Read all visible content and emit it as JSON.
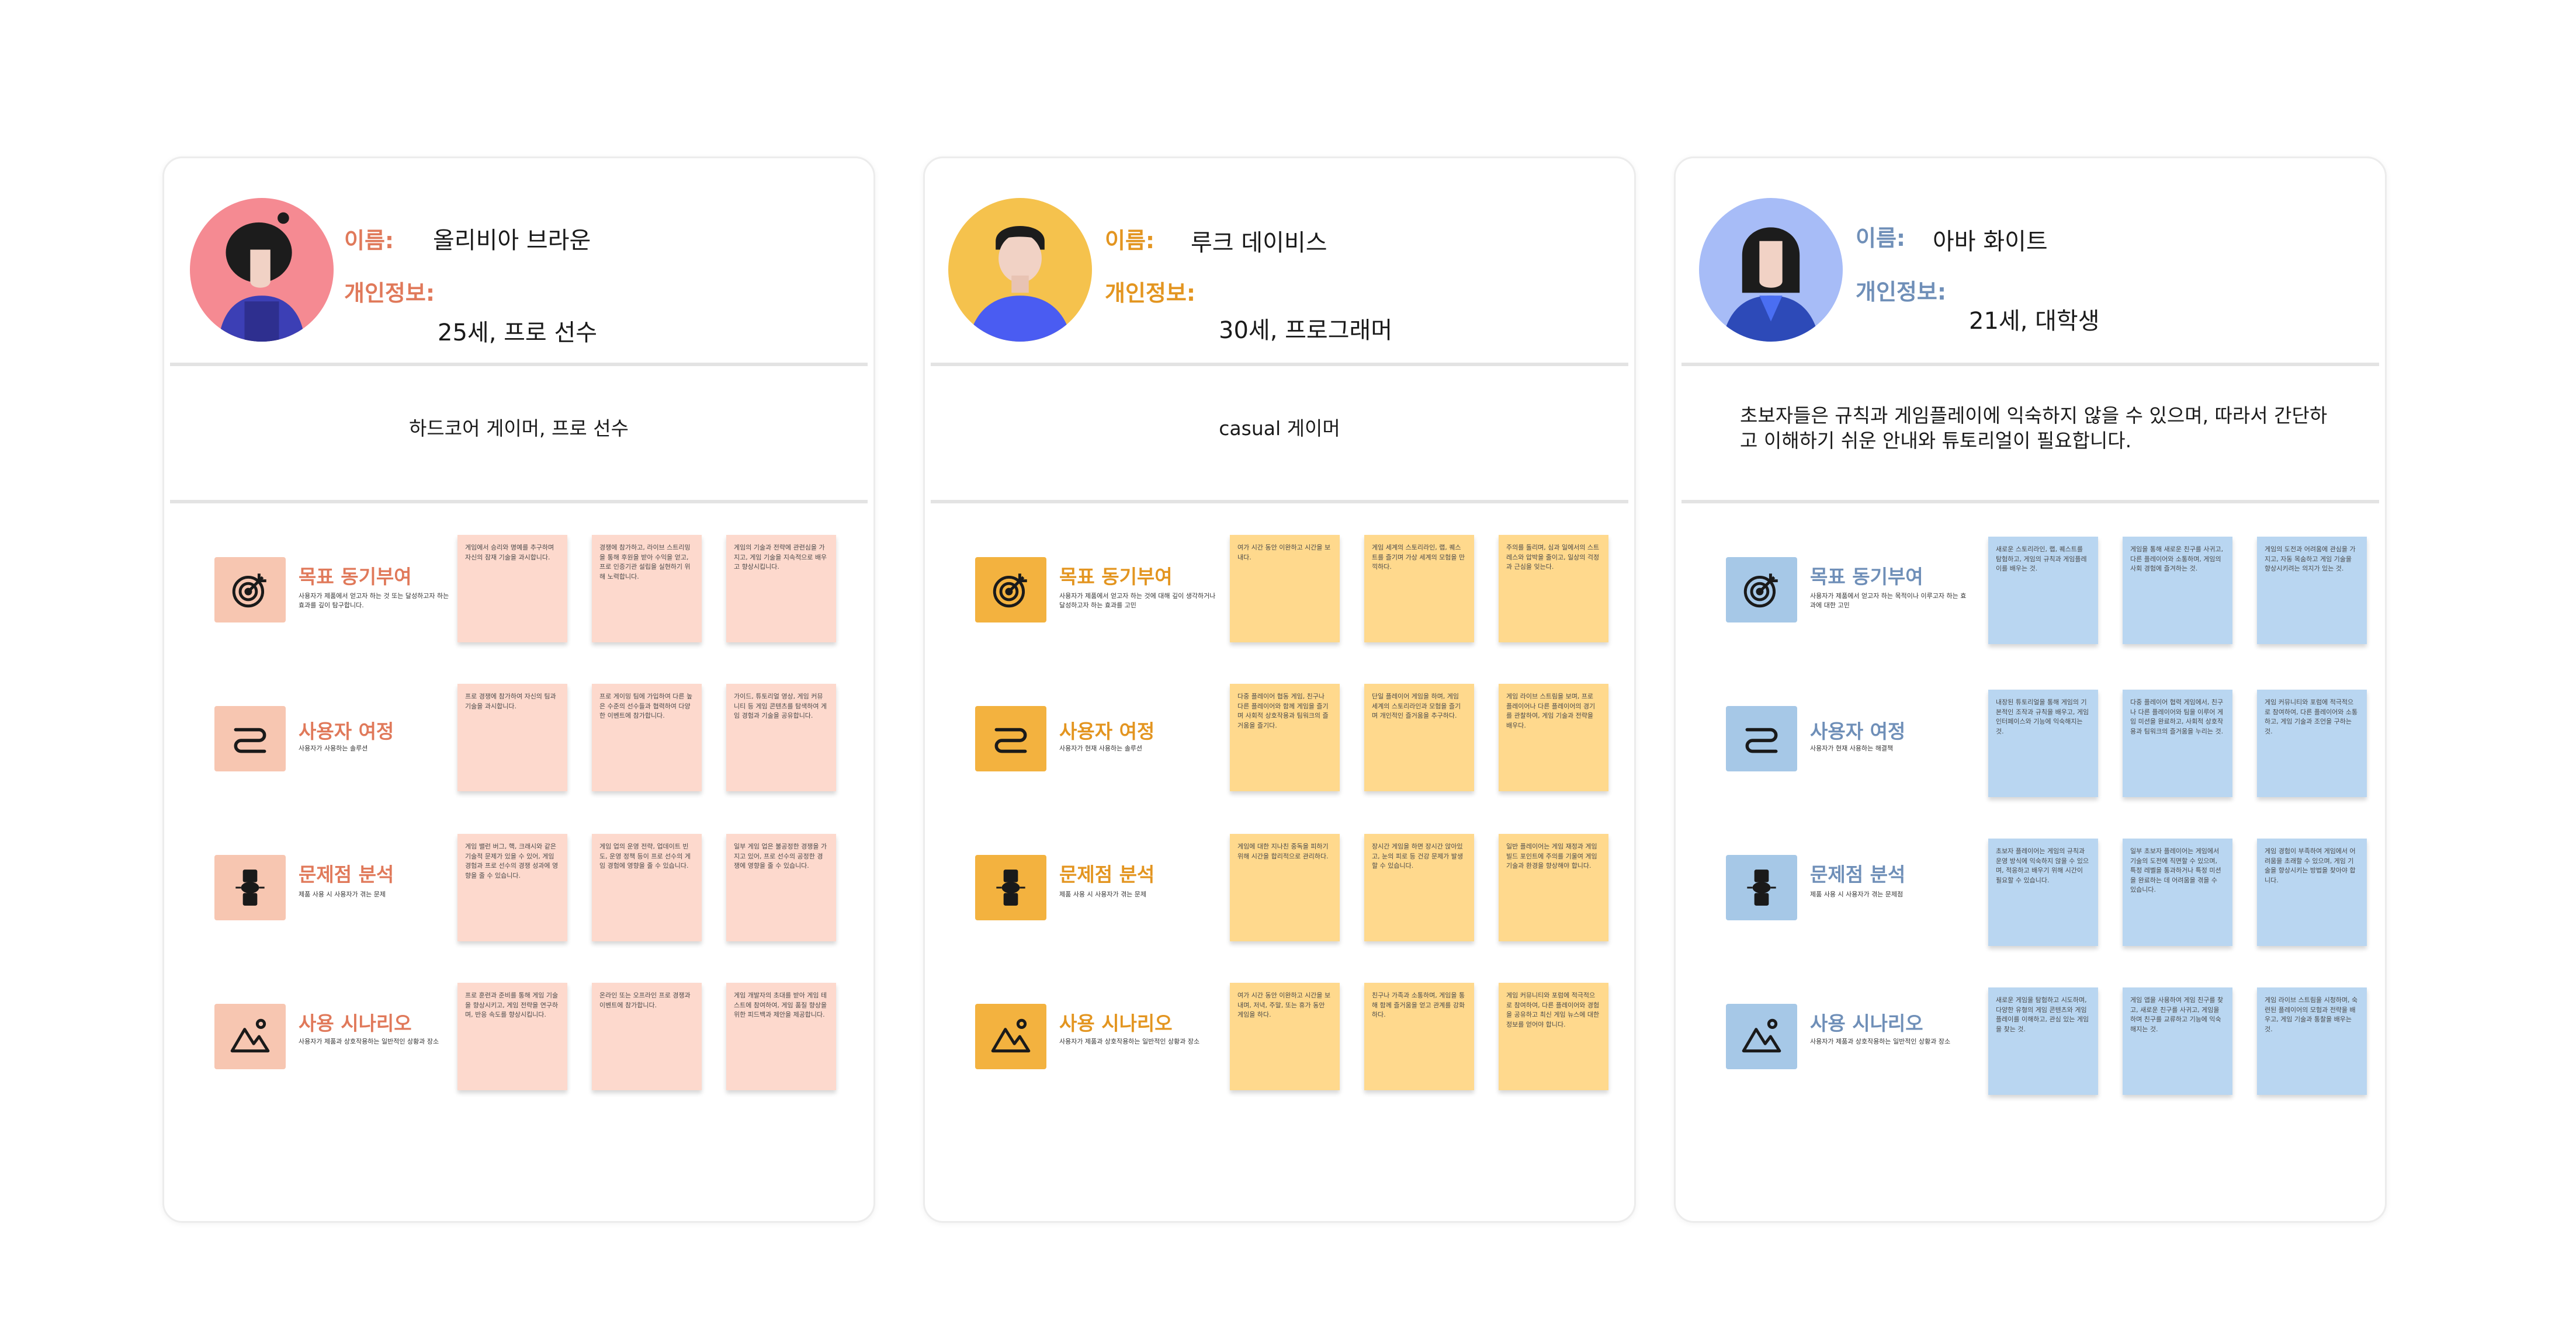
{
  "labels": {
    "name": "이름:",
    "info": "개인정보:"
  },
  "section_titles": [
    "목표 동기부여",
    "사용자 여정",
    "문제점  분석",
    "사용 시나리오"
  ],
  "section_icons": [
    "target-icon",
    "route-icon",
    "knee-joint-icon",
    "landscape-icon"
  ],
  "personas": [
    {
      "accent": "#e0795a",
      "icon_bg": "#f7c6b1",
      "note_color": "#fdd9cd",
      "avatar_bg": "#f58a92",
      "name": "올리비아 브라운",
      "info": "25세, 프로 선수",
      "description": "하드코어 게이머, 프로 선수",
      "section_subtitles": [
        "사용자가 제품에서 얻고자 하는 것 또는 달성하고자 하는 효과를 깊이 탐구합니다.",
        "사용자가 사용하는 솔루션",
        "제품 사용 시 사용자가 겪는 문제",
        "사용자가 제품과 상호작용하는 일반적인 상황과 장소"
      ],
      "notes": [
        [
          "게임에서 승리와 명예를 추구하며 자신의 잠재 기술을 과시합니다.",
          "경쟁에 참가하고, 라이브 스트리밍을 통해 후원을 받아 수익을 얻고, 프로 인증기관 설립을 실현하기 위해 노력합니다.",
          "게임의 기술과 전략에 관련심을 가지고, 게임 기술을 지속적으로 배우고 향상시킵니다."
        ],
        [
          "프로 경쟁에 참가하여 자신의 팀과 기술을 과시합니다.",
          "프로 게이밍 팀에 가입하여 다른 높은 수준의 선수들과 협력하여 다양한 이벤트에 참가합니다.",
          "가이드, 튜토리얼 영상, 게임 커뮤니티 등 게임 콘텐츠를 탐색하여 게임 경험과 기술을 공유합니다."
        ],
        [
          "게임 밸런 버그, 핵, 크래시와 같은 기술적 문제가 있을 수 있어, 게임 경험과 프로 선수의 경쟁 성과에 영향을 줄 수 있습니다.",
          "게임 업의 운영 전략, 업데이트 빈도, 운영 정책 등이 프로 선수의 게임 경험에 영향을 줄 수 있습니다.",
          "일부 게임 업은 불공정한 경쟁을 가지고 있어, 프로 선수의 공정한 경쟁에 영향을 줄 수 있습니다."
        ],
        [
          "프로 훈련과 준비를 통해 게임 기술을 향상시키고, 게임 전략을 연구하며, 반응 속도를 향상시킵니다.",
          "온라인 또는 오프라인 프로 경쟁과 이벤트에 참가합니다.",
          "게임 개발자의 초대를 받아 게임 테스트에 참여하여, 게임 품질 향상을 위한 피드백과 제안을 제공합니다."
        ]
      ]
    },
    {
      "accent": "#e39520",
      "icon_bg": "#f3b23f",
      "note_color": "#ffd98d",
      "avatar_bg": "#f5c24d",
      "name": "루크 데이비스",
      "info": "30세, 프로그래머",
      "description": "casual 게이머",
      "section_subtitles": [
        "사용자가 제품에서 얻고자 하는 것에 대해 깊이 생각하거나 달성하고자 하는 효과를 고민",
        "사용자가 현재 사용하는 솔루션",
        "제품 사용 시 사용자가 겪는 문제",
        "사용자가 제품과 상호작용하는 일반적인 상황과 장소"
      ],
      "notes": [
        [
          "여가 시간 동안 이완하고 시간을 보내다.",
          "게임 세계의 스토리라인, 랩, 퀘스트를 즐기며 가상 세계의 모험을 만끽하다.",
          "주의를 돌리며, 심과 일에서의 스트레스와 압박을 줄이고, 일상의 걱정과 근심을 잊는다."
        ],
        [
          "다중 플레이어 협동 게임, 친구나 다른 플레이어와 함께 게임을 즐기며 사회적 상호작용과 팀워크의 즐거움을 즐기다.",
          "단일 플레이어 게임을 하며, 게임 세계의 스토리라인과 모험을 즐기며 개인적인 즐거움을 추구하다.",
          "게임 라이브 스트림을 보며, 프로 플레이어나 다른 플레이어의 경기를 관찰하여, 게임 기술과 전략을 배우다."
        ],
        [
          "게임에 대한 지나친 중독을 피하기 위해 시간을 합리적으로 관리하다.",
          "장시간 게임을 하면 장시간 앉아있고, 눈의 피로 등 건강 문제가 발생할 수 있습니다.",
          "일반 플레이어는 게임 재정과 게임 빌드 포인트에 주의를 기울여 게임 기술과 환경을 향상해야 합니다."
        ],
        [
          "여가 시간 동안 이완하고 시간을 보내며, 저녁, 주말, 또는 휴가 동안 게임을 하다.",
          "친구나 가족과 소통하며, 게임을 통해 함께 즐거움을 얻고 관계를 강화하다.",
          "게임 커뮤니티와 포럼에 적극적으로 참여하여, 다른 플레이어와 경험을 공유하고 최신 게임 뉴스에 대한 정보를 얻어야 합니다."
        ]
      ]
    },
    {
      "accent": "#6f8fb8",
      "icon_bg": "#a6c8e7",
      "note_color": "#b9d6f1",
      "avatar_bg": "#a7bcf7",
      "name": "아바 화이트",
      "info": "21세, 대학생",
      "description": "초보자들은 규칙과 게임플레이에 익숙하지 않을 수 있으며, 따라서 간단하고 이해하기 쉬운 안내와 튜토리얼이 필요합니다.",
      "section_subtitles": [
        "사용자가 제품에서 얻고자 하는 목적이나 이루고자 하는 효과에 대한 고민",
        "사용자가 현재 사용하는 해결책",
        "제품 사용 시 사용자가 겪는 문제점",
        "사용자가 제품과 상호작용하는 일반적인 상황과 장소"
      ],
      "notes": [
        [
          "새로운 스토리라인, 랩, 퀘스트를 탐험하고, 게임의 규칙과 게임플레이를 배우는 것.",
          "게임을 통해 새로운 친구를 사귀고, 다른 플레이어와 소통하며, 게임의 사회 경험에 즐겨하는 것.",
          "게임의 도전과 어려움에 관심을 가지고, 자동 목숨하고 게임 기술을 향상시키려는 의지가 있는 것."
        ],
        [
          "내장된 튜토리얼을 통해 게임의 기본적인 조작과 규칙을 배우고, 게임 인터페이스와 기능에 익숙해지는 것.",
          "다중 플레이어 협력 게임에서, 친구나 다른 플레이어와 팀을 이루어 게임 미션을 완료하고, 사회적 상호작용과 팀워크의 즐거움을 누리는 것.",
          "게임 커뮤니티와 포럼에 적극적으로 참여하여, 다른 플레이어와 소통하고, 게임 기술과 조언을 구하는 것."
        ],
        [
          "초보자 플레이어는 게임의 규칙과 운영 방식에 익숙하지 않을 수 있으며, 적응하고 배우기 위해 시간이 필요할 수 있습니다.",
          "일부 초보자 플레이어는 게임에서 기술의 도전에 직면할 수 있으며, 특정 레벨을 통과하거나 특정 미션을 완료하는 데 어려움을 겪을 수 있습니다.",
          "게임 경험이 부족하여 게임에서 어려움을 초래할 수 있으며, 게임 기술을 향상시키는 방법을 찾아야 합니다."
        ],
        [
          "새로운 게임을 탐험하고 시도하며, 다양한 유형의 게임 콘텐츠와 게임플레이를 이해하고, 관심 있는 게임을 찾는 것.",
          "게임 앱을 사용하여 게임 친구를 찾고, 새로운 친구를 사귀고, 게임을 하며 친구를 교류하고 기능에 익숙해지는 것.",
          "게임 라이브 스트림을 시청하며, 숙련된 플레이어의 모험과 전략을 배우고, 게임 기술과 통찰을 배우는 것."
        ]
      ]
    }
  ]
}
